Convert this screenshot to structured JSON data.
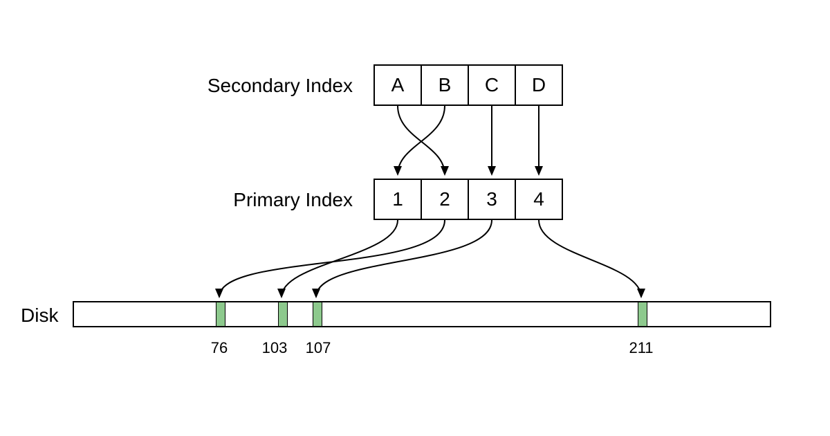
{
  "secondaryLabel": "Secondary Index",
  "primaryLabel": "Primary Index",
  "diskLabel": "Disk",
  "secondaryCells": [
    "A",
    "B",
    "C",
    "D"
  ],
  "primaryCells": [
    "1",
    "2",
    "3",
    "4"
  ],
  "diskPositions": [
    "76",
    "103",
    "107",
    "211"
  ],
  "colors": {
    "block": "#8dc98d",
    "stroke": "#000000"
  },
  "mapping": {
    "secondary_to_primary": {
      "A": 2,
      "B": 1,
      "C": 3,
      "D": 4
    },
    "primary_to_disk": {
      "1": 103,
      "2": 76,
      "3": 107,
      "4": 211
    }
  }
}
